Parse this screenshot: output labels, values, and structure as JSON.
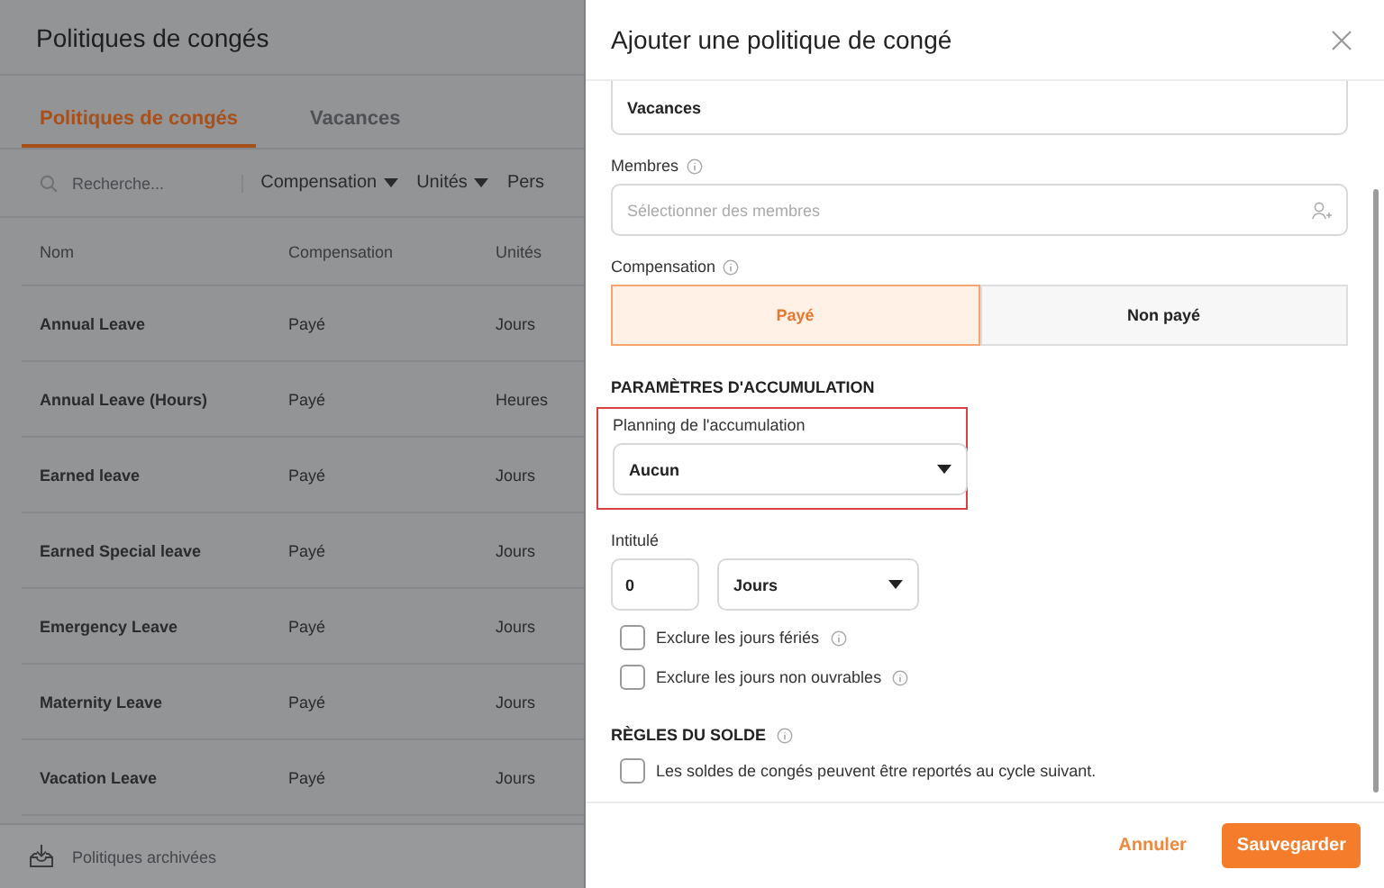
{
  "page": {
    "title": "Politiques de congés",
    "tabs": [
      {
        "label": "Politiques de congés",
        "selected": true
      },
      {
        "label": "Vacances",
        "selected": false
      }
    ],
    "search": {
      "placeholder": "Recherche..."
    },
    "filters": [
      "Compensation",
      "Unités",
      "Pers"
    ],
    "table": {
      "columns": [
        "Nom",
        "Compensation",
        "Unités"
      ],
      "rows": [
        [
          "Annual Leave",
          "Payé",
          "Jours"
        ],
        [
          "Annual Leave (Hours)",
          "Payé",
          "Heures"
        ],
        [
          "Earned leave",
          "Payé",
          "Jours"
        ],
        [
          "Earned Special leave",
          "Payé",
          "Jours"
        ],
        [
          "Emergency Leave",
          "Payé",
          "Jours"
        ],
        [
          "Maternity Leave",
          "Payé",
          "Jours"
        ],
        [
          "Vacation Leave",
          "Payé",
          "Jours"
        ]
      ]
    },
    "footer": {
      "label": "Politiques archivées"
    }
  },
  "drawer": {
    "title": "Ajouter une politique de congé",
    "name_field": {
      "value": "Vacances"
    },
    "members": {
      "label": "Membres",
      "placeholder": "Sélectionner des membres"
    },
    "compensation": {
      "label": "Compensation",
      "options": [
        {
          "label": "Payé",
          "selected": true
        },
        {
          "label": "Non payé",
          "selected": false
        }
      ]
    },
    "accrual_heading": "PARAMÈTRES D'ACCUMULATION",
    "accrual_schedule": {
      "label": "Planning de l'accumulation",
      "value": "Aucun",
      "highlighted": true
    },
    "entitlement": {
      "label": "Intitulé",
      "amount": "0",
      "unit": "Jours"
    },
    "exclusions": [
      {
        "label": "Exclure les jours fériés",
        "checked": false
      },
      {
        "label": "Exclure les jours non ouvrables",
        "checked": false
      }
    ],
    "balance_heading": "RÈGLES DU SOLDE",
    "balance_rules": [
      {
        "label": "Les soldes de congés peuvent être reportés au cycle suivant.",
        "checked": false
      }
    ],
    "buttons": {
      "cancel": "Annuler",
      "save": "Sauvegarder"
    }
  }
}
